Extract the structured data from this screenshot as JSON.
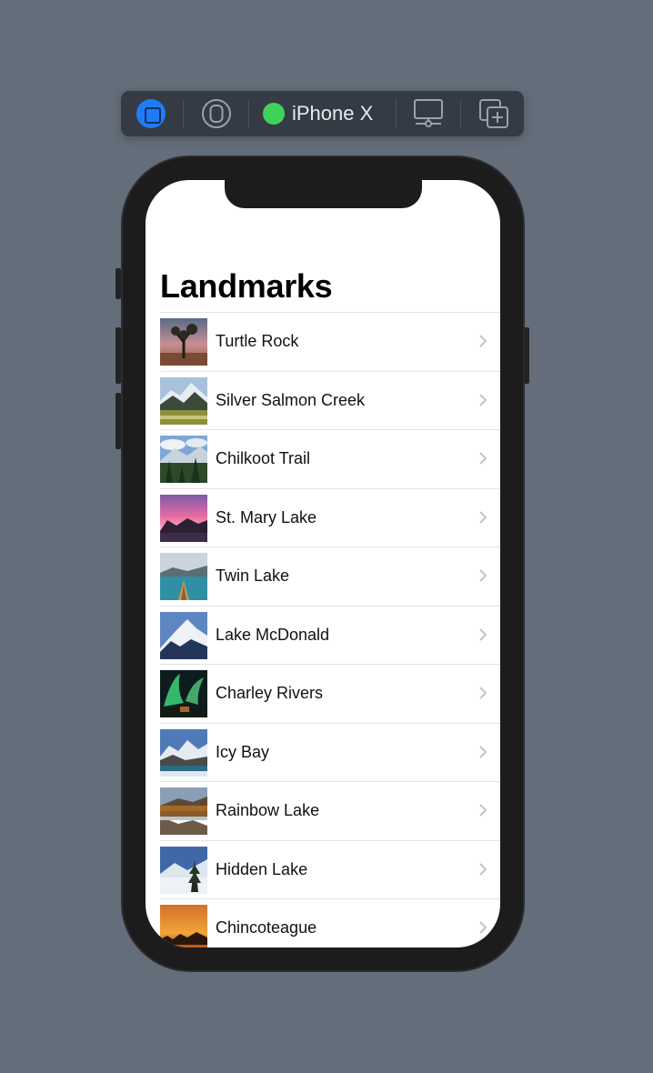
{
  "toolbar": {
    "device_name": "iPhone X",
    "device_status_color": "#3fd259",
    "accent_color": "#1f7cf5"
  },
  "screen": {
    "nav_title": "Landmarks",
    "landmarks": [
      {
        "name": "Turtle Rock",
        "thumb_icon": "joshua-tree-photo"
      },
      {
        "name": "Silver Salmon Creek",
        "thumb_icon": "mountain-meadow-photo"
      },
      {
        "name": "Chilkoot Trail",
        "thumb_icon": "forest-mountain-photo"
      },
      {
        "name": "St. Mary Lake",
        "thumb_icon": "sunset-lake-photo"
      },
      {
        "name": "Twin Lake",
        "thumb_icon": "canoe-lake-photo"
      },
      {
        "name": "Lake McDonald",
        "thumb_icon": "snowy-peak-photo"
      },
      {
        "name": "Charley Rivers",
        "thumb_icon": "aurora-photo"
      },
      {
        "name": "Icy Bay",
        "thumb_icon": "glacier-bay-photo"
      },
      {
        "name": "Rainbow Lake",
        "thumb_icon": "reflection-lake-photo"
      },
      {
        "name": "Hidden Lake",
        "thumb_icon": "winter-tree-photo"
      },
      {
        "name": "Chincoteague",
        "thumb_icon": "orange-sunset-photo"
      }
    ]
  }
}
